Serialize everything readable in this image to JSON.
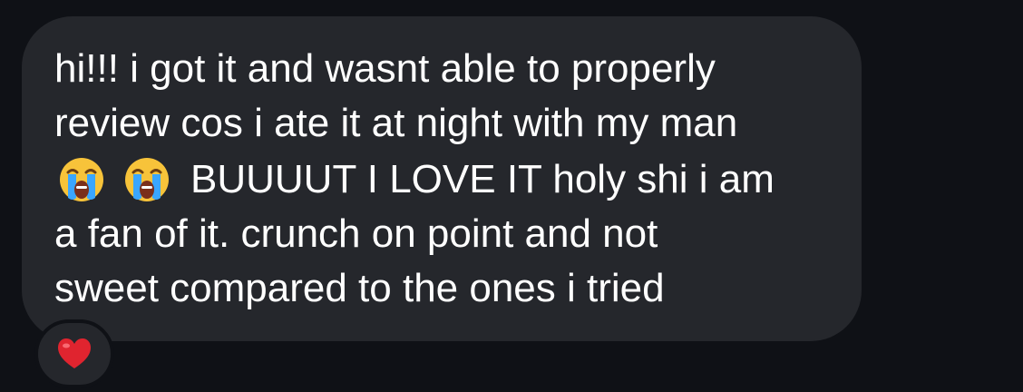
{
  "message": {
    "line1": "hi!!! i got it and wasnt able to properly",
    "line2": "review cos i ate it at night with my man",
    "line3_emojis": [
      "loudly-crying-face-icon",
      "loudly-crying-face-icon"
    ],
    "line3_text": "BUUUUT I LOVE IT holy shi i am",
    "line4": "a fan of it. crunch on point and not",
    "line5": "sweet compared to the ones i tried"
  },
  "reaction": {
    "icon": "red-heart-icon",
    "color": "#e0242f"
  },
  "colors": {
    "background": "#0f1116",
    "bubble": "#25272c",
    "text": "#ffffff"
  }
}
